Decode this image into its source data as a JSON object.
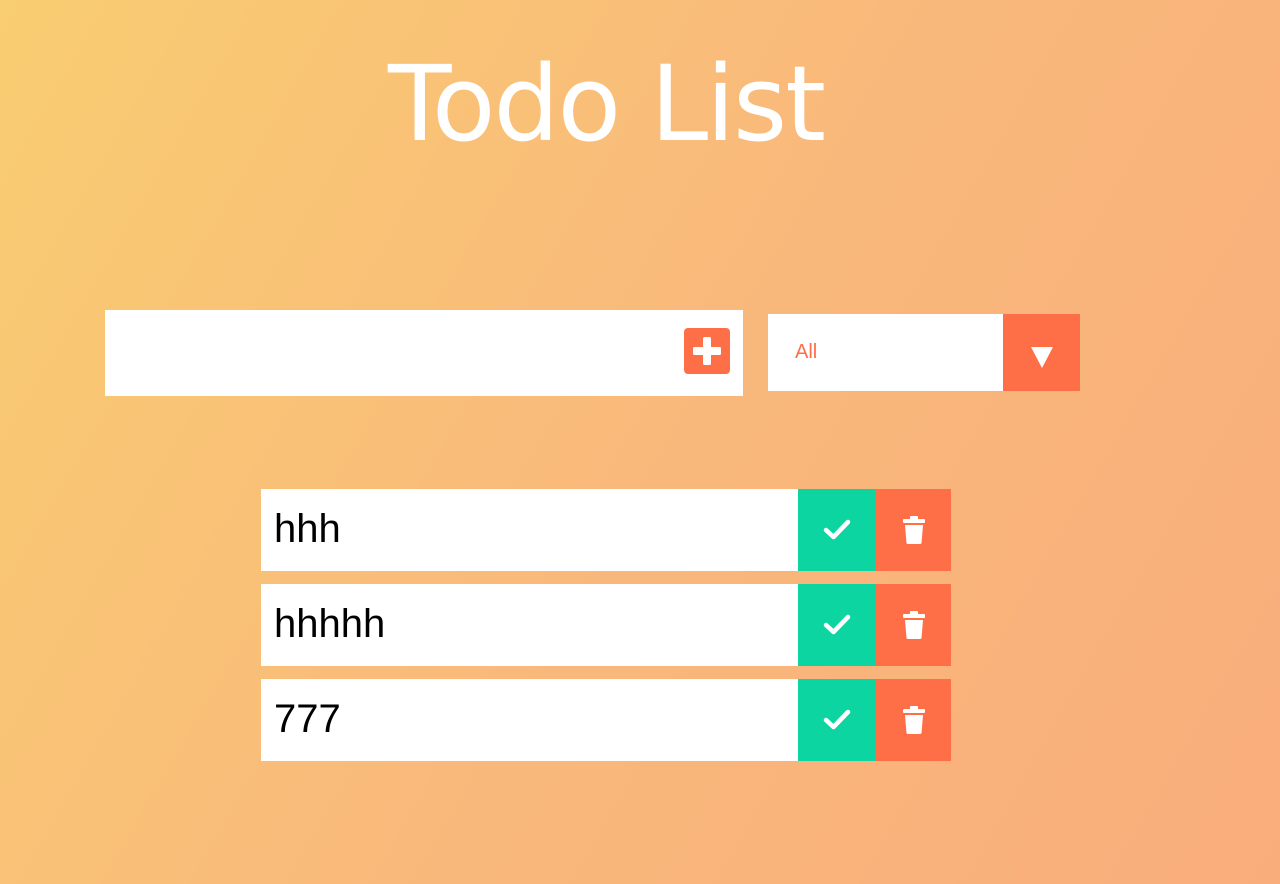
{
  "header": {
    "title": "Todo List"
  },
  "form": {
    "input_value": "",
    "input_placeholder": "",
    "add_icon": "plus-square-icon"
  },
  "filter": {
    "selected": "All",
    "arrow_icon": "caret-down-icon"
  },
  "todos": [
    {
      "text": "hhh"
    },
    {
      "text": "hhhhh"
    },
    {
      "text": "777"
    }
  ],
  "icons": {
    "complete": "check-icon",
    "delete": "trash-icon"
  },
  "colors": {
    "accent": "#ff6f47",
    "complete": "#0dd5a1",
    "gradient_start": "#f9cd71",
    "gradient_end": "#f9ad7b",
    "title": "#ffffff"
  }
}
